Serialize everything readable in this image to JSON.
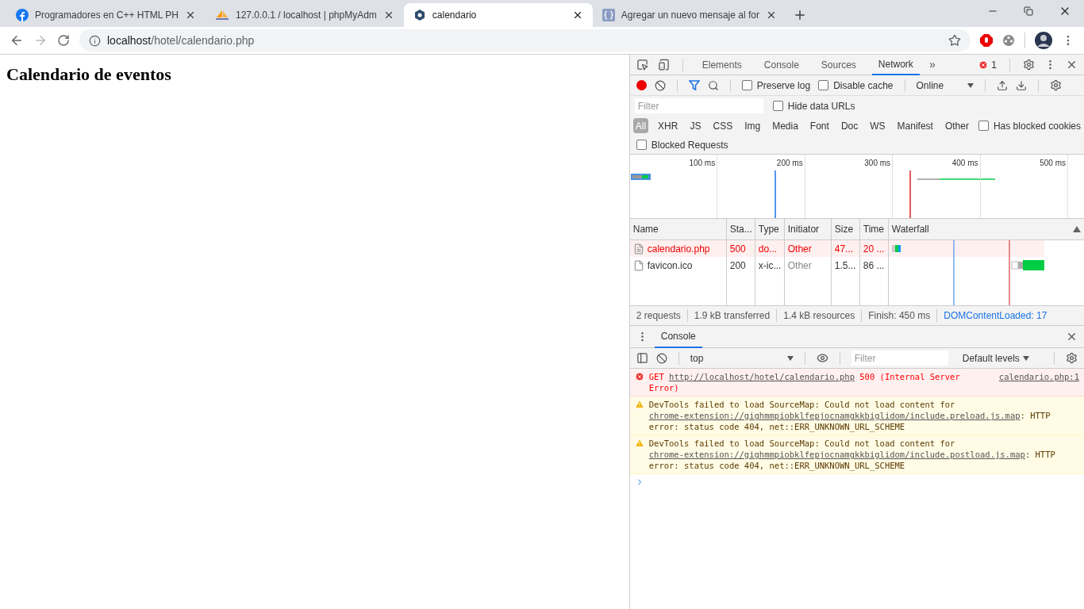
{
  "browser": {
    "tabs": [
      {
        "title": "Programadores en C++ HTML PH",
        "kind": "facebook",
        "selected": false
      },
      {
        "title": "127.0.0.1 / localhost | phpMyAdm",
        "kind": "sailboat",
        "selected": false
      },
      {
        "title": "calendario",
        "kind": "hexagon",
        "selected": true
      },
      {
        "title": "Agregar un nuevo mensaje al for",
        "kind": "braces",
        "selected": false
      }
    ],
    "url": {
      "host": "localhost",
      "path": "/hotel/calendario.php"
    }
  },
  "page": {
    "heading": "Calendario de eventos"
  },
  "devtools": {
    "tabs": [
      {
        "label": "Elements",
        "selected": false
      },
      {
        "label": "Console",
        "selected": false
      },
      {
        "label": "Sources",
        "selected": false
      },
      {
        "label": "Network",
        "selected": true
      }
    ],
    "more": "»",
    "error_count": "1",
    "toolbar": {
      "recording": true,
      "preserve_log": {
        "label": "Preserve log",
        "checked": false
      },
      "disable_cache": {
        "label": "Disable cache",
        "checked": false
      },
      "throttling": "Online"
    },
    "filter": {
      "placeholder": "Filter",
      "hide_data_urls": {
        "label": "Hide data URLs",
        "checked": false
      }
    },
    "types": [
      {
        "label": "All",
        "selected": true
      },
      {
        "label": "XHR",
        "selected": false
      },
      {
        "label": "JS",
        "selected": false
      },
      {
        "label": "CSS",
        "selected": false
      },
      {
        "label": "Img",
        "selected": false
      },
      {
        "label": "Media",
        "selected": false
      },
      {
        "label": "Font",
        "selected": false
      },
      {
        "label": "Doc",
        "selected": false
      },
      {
        "label": "WS",
        "selected": false
      },
      {
        "label": "Manifest",
        "selected": false
      },
      {
        "label": "Other",
        "selected": false
      }
    ],
    "has_blocked_cookies": {
      "label": "Has blocked cookies",
      "checked": false
    },
    "blocked_requests": {
      "label": "Blocked Requests",
      "checked": false
    },
    "overview_ticks": [
      "100 ms",
      "200 ms",
      "300 ms",
      "400 ms",
      "500 ms"
    ],
    "table": {
      "columns": [
        "Name",
        "Sta...",
        "Type",
        "Initiator",
        "Size",
        "Time",
        "Waterfall"
      ],
      "rows": [
        {
          "error": true,
          "cells": [
            "calendario.php",
            "500",
            "do...",
            "Other",
            "47...",
            "20 ..."
          ]
        },
        {
          "error": false,
          "cells": [
            "favicon.ico",
            "200",
            "x-ic...",
            "Other",
            "1.5...",
            "86 ..."
          ]
        }
      ]
    },
    "summary": [
      "2 requests",
      "1.9 kB transferred",
      "1.4 kB resources",
      "Finish: 450 ms",
      "DOMContentLoaded: 17"
    ],
    "drawer": {
      "tab": {
        "label": "Console",
        "selected": true
      },
      "context": "top",
      "filter_placeholder": "Filter",
      "levels": "Default levels",
      "messages": [
        {
          "kind": "error",
          "before": "GET ",
          "link": "http://localhost/hotel/calendario.php",
          "after": " 500 (Internal Server Error)",
          "source": "calendario.php:1"
        },
        {
          "kind": "warning",
          "before": "DevTools failed to load SourceMap: Could not load content for ",
          "link": "chrome-extension://gighmmpiobklfepjocnamgkkbiglidom/include.preload.js.map",
          "after": ": HTTP error: status code 404, net::ERR_UNKNOWN_URL_SCHEME"
        },
        {
          "kind": "warning",
          "before": "DevTools failed to load SourceMap: Could not load content for ",
          "link": "chrome-extension://gighmmpiobklfepjocnamgkkbiglidom/include.postload.js.map",
          "after": ": HTTP error: status code 404, net::ERR_UNKNOWN_URL_SCHEME"
        }
      ]
    }
  }
}
